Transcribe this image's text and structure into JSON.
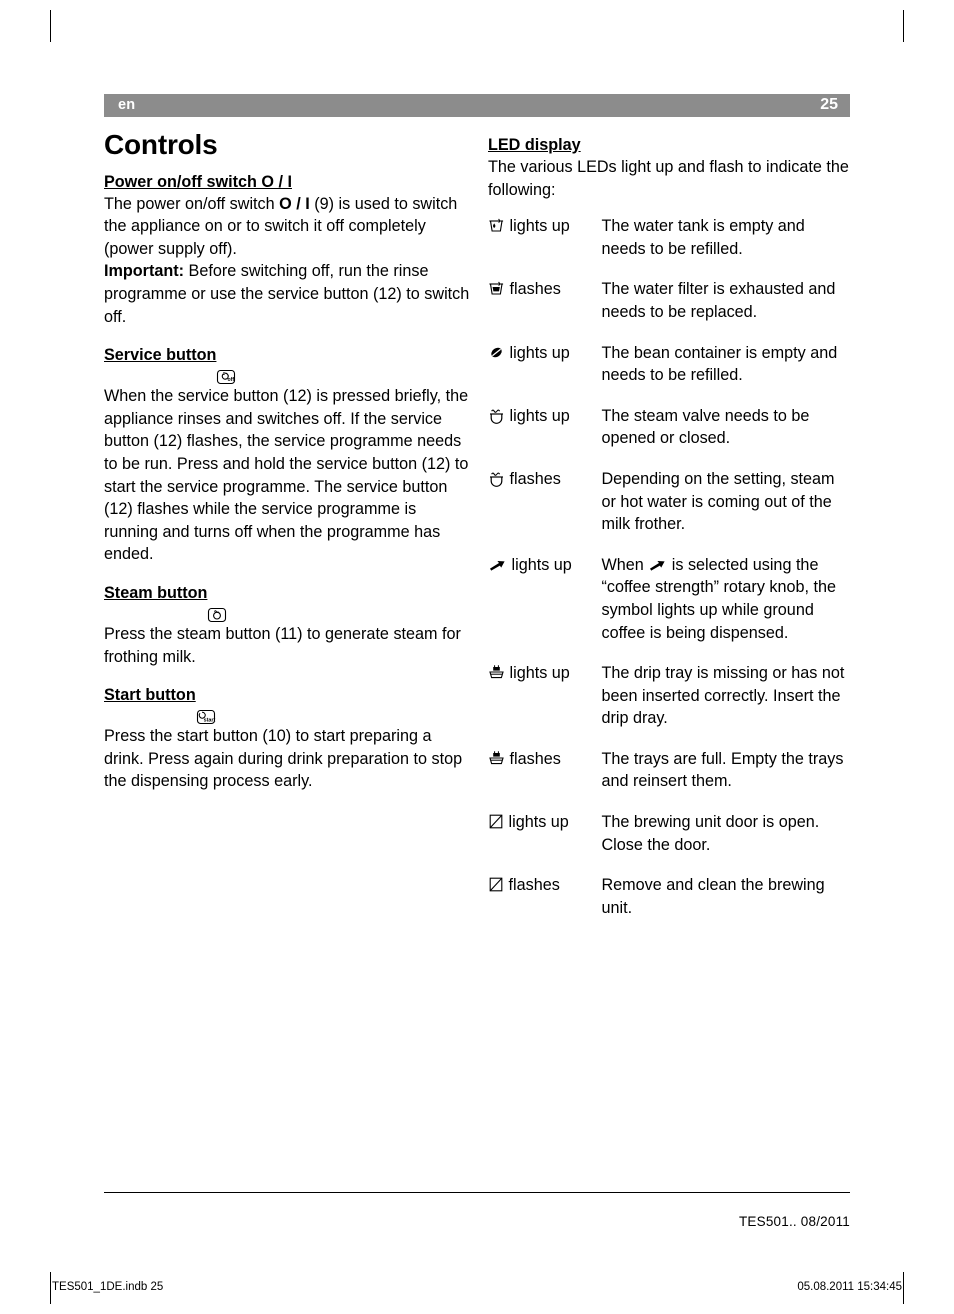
{
  "header": {
    "language": "en",
    "page_number": "25"
  },
  "left_column": {
    "title": "Controls",
    "sections": [
      {
        "heading": "Power on/off switch O / I",
        "heading_icon": "",
        "paragraphs": [
          "The power on/off switch O / I (9) is used to switch the appliance on or to switch it off completely (power supply off).",
          "Important: Before switching off, run the rinse programme or use the service button (12) to switch off."
        ]
      },
      {
        "heading": "Service button",
        "heading_icon": "service-button-icon",
        "paragraphs": [
          "When the service button (12) is pressed briefly, the appliance rinses and switches off. If the service button (12) flashes, the service programme needs to be run. Press and hold the service button (12) to start the service programme. The service button (12) flashes while the service programme is running and turns off when the programme has ended."
        ]
      },
      {
        "heading": "Steam button",
        "heading_icon": "steam-button-icon",
        "paragraphs": [
          "Press the steam button (11) to generate steam for frothing milk."
        ]
      },
      {
        "heading": "Start button",
        "heading_icon": "start-button-icon",
        "paragraphs": [
          "Press the start button (10) to start preparing a drink. Press again during drink preparation to stop the dispensing process early."
        ]
      }
    ]
  },
  "right_column": {
    "heading": "LED display",
    "intro": "The various LEDs light up and flash to indicate the following:",
    "rows": [
      {
        "icon": "water-tank-icon",
        "state": "lights up",
        "description": "The water tank is empty and needs to be refilled."
      },
      {
        "icon": "water-filter-icon",
        "state": "flashes",
        "description": "The water filter is exhausted and needs to be replaced."
      },
      {
        "icon": "bean-container-icon",
        "state": "lights up",
        "description": "The bean container is empty and needs to be refilled."
      },
      {
        "icon": "steam-valve-icon",
        "state": "lights up",
        "description": "The steam valve needs to be opened or closed."
      },
      {
        "icon": "steam-valve-icon",
        "state": "flashes",
        "description": "Depending on the setting, steam or hot water is coming out of the milk frother."
      },
      {
        "icon": "ground-coffee-icon",
        "state": "lights up",
        "description_before": "When",
        "description_after": "is selected using the “coffee strength” rotary knob, the symbol lights up while ground coffee is being dispensed."
      },
      {
        "icon": "drip-tray-icon",
        "state": "lights up",
        "description": "The drip tray is missing or has not been inserted correctly. Insert the drip dray."
      },
      {
        "icon": "drip-tray-icon",
        "state": "flashes",
        "description": "The trays are full. Empty the trays and reinsert them."
      },
      {
        "icon": "brewing-unit-icon",
        "state": "lights up",
        "description": "The brewing unit door is open. Close the door."
      },
      {
        "icon": "brewing-unit-icon",
        "state": "flashes",
        "description": "Remove and clean the brewing unit."
      }
    ]
  },
  "footer": {
    "document_code": "TES501..   08/2011",
    "baseline_left": "TES501_1DE.indb   25",
    "baseline_right": "05.08.2011   15:34:45"
  }
}
